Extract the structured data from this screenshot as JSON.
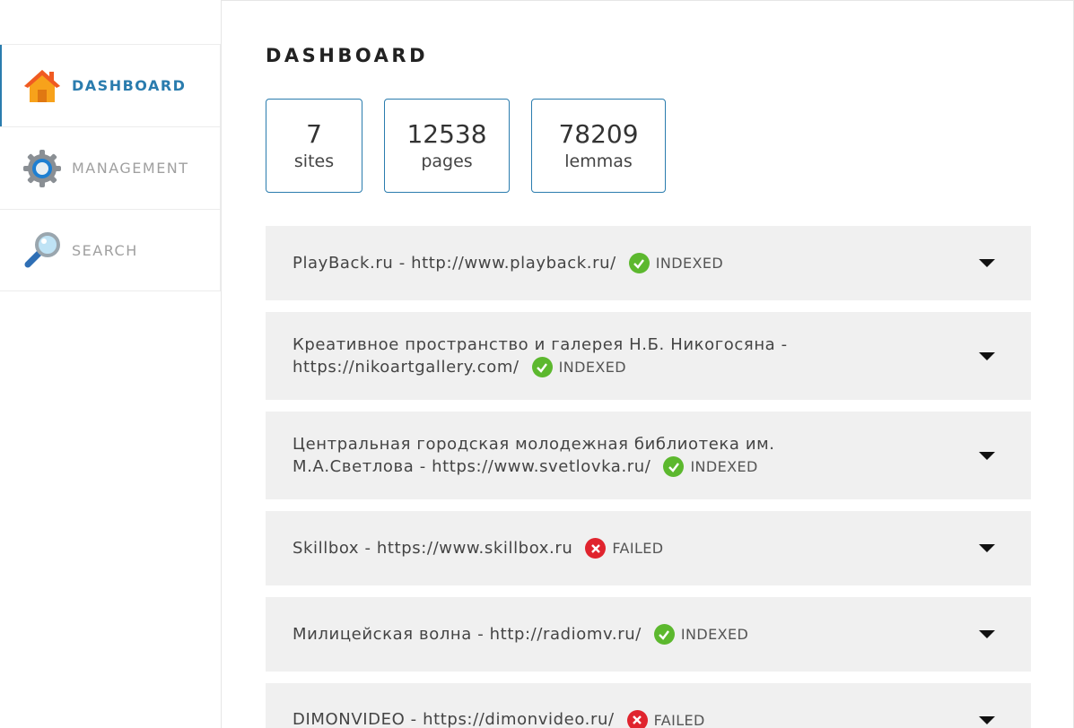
{
  "sidebar": {
    "items": [
      {
        "label": "DASHBOARD",
        "icon": "home-icon",
        "active": true
      },
      {
        "label": "MANAGEMENT",
        "icon": "gear-icon",
        "active": false
      },
      {
        "label": "SEARCH",
        "icon": "magnifier-icon",
        "active": false
      }
    ]
  },
  "main": {
    "title": "DASHBOARD",
    "stats": [
      {
        "value": "7",
        "label": "sites"
      },
      {
        "value": "12538",
        "label": "pages"
      },
      {
        "value": "78209",
        "label": "lemmas"
      }
    ],
    "sites": [
      {
        "line1": "PlayBack.ru - http://www.playback.ru/",
        "line2": "",
        "status": "INDEXED"
      },
      {
        "line1": "Креативное пространство и галерея Н.Б. Никогосяна -",
        "line2": "https://nikoartgallery.com/",
        "status": "INDEXED"
      },
      {
        "line1": "Центральная городская молодежная библиотека им.",
        "line2": "М.А.Светлова - https://www.svetlovka.ru/",
        "status": "INDEXED"
      },
      {
        "line1": "Skillbox - https://www.skillbox.ru",
        "line2": "",
        "status": "FAILED"
      },
      {
        "line1": "Милицейская волна - http://radiomv.ru/",
        "line2": "",
        "status": "INDEXED"
      },
      {
        "line1": "DIMONVIDEO - https://dimonvideo.ru/",
        "line2": "",
        "status": "FAILED"
      }
    ]
  },
  "colors": {
    "accent": "#2a7cae",
    "indexed": "#5cb82e",
    "failed": "#e0242e",
    "panel": "#f0f0f0"
  }
}
